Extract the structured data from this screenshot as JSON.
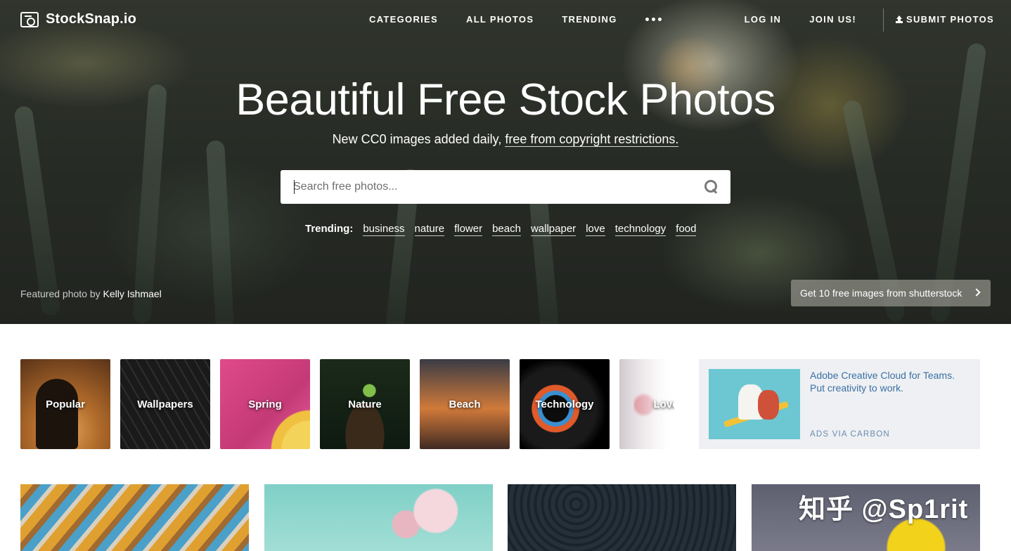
{
  "brand": {
    "logo_text": "StockSnap.io"
  },
  "nav": {
    "center": [
      "CATEGORIES",
      "ALL PHOTOS",
      "TRENDING"
    ],
    "right": [
      "LOG IN",
      "JOIN US!"
    ],
    "submit": "SUBMIT PHOTOS"
  },
  "hero": {
    "title": "Beautiful Free Stock Photos",
    "subtitle_prefix": "New CC0 images added daily, ",
    "subtitle_link": "free from copyright restrictions.",
    "search_placeholder": "Search free photos...",
    "trending_label": "Trending:",
    "trending_tags": [
      "business",
      "nature",
      "flower",
      "beach",
      "wallpaper",
      "love",
      "technology",
      "food"
    ],
    "credit_prefix": "Featured photo by ",
    "credit_author": "Kelly Ishmael",
    "shutterstock_button": "Get 10 free images from shutterstock"
  },
  "categories": [
    "Popular",
    "Wallpapers",
    "Spring",
    "Nature",
    "Beach",
    "Technology",
    "Love"
  ],
  "ad": {
    "text": "Adobe Creative Cloud for Teams. Put creativity to work.",
    "via": "ADS VIA CARBON"
  },
  "watermark": "知乎 @Sp1rit"
}
